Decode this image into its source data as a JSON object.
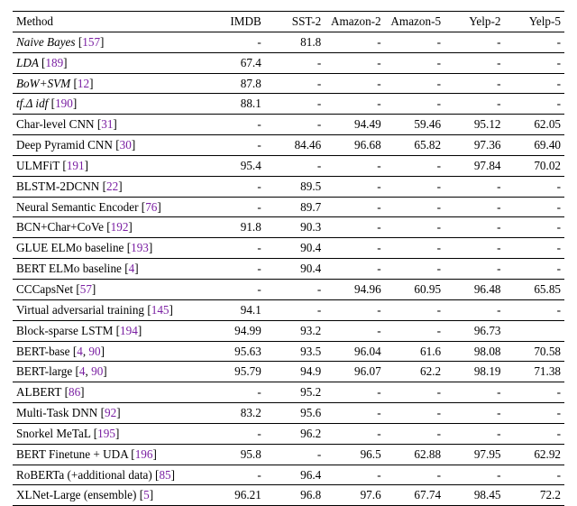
{
  "chart_data": {
    "type": "table",
    "title": "",
    "columns": [
      "Method",
      "IMDB",
      "SST-2",
      "Amazon-2",
      "Amazon-5",
      "Yelp-2",
      "Yelp-5"
    ],
    "rows": [
      {
        "method": "Naive Bayes",
        "ref": "157",
        "italic": true,
        "values": [
          "-",
          "81.8",
          "-",
          "-",
          "-",
          "-"
        ]
      },
      {
        "method": "LDA",
        "ref": "189",
        "italic": true,
        "values": [
          "67.4",
          "-",
          "-",
          "-",
          "-",
          "-"
        ]
      },
      {
        "method": "BoW+SVM",
        "ref": "12",
        "italic": true,
        "values": [
          "87.8",
          "-",
          "-",
          "-",
          "-",
          "-"
        ]
      },
      {
        "method": "tf.Δ idf",
        "ref": "190",
        "italic": true,
        "values": [
          "88.1",
          "-",
          "-",
          "-",
          "-",
          "-"
        ]
      },
      {
        "method": "Char-level CNN",
        "ref": "31",
        "italic": false,
        "values": [
          "-",
          "-",
          "94.49",
          "59.46",
          "95.12",
          "62.05"
        ]
      },
      {
        "method": "Deep Pyramid CNN",
        "ref": "30",
        "italic": false,
        "values": [
          "-",
          "84.46",
          "96.68",
          "65.82",
          "97.36",
          "69.40"
        ]
      },
      {
        "method": "ULMFiT",
        "ref": "191",
        "italic": false,
        "values": [
          "95.4",
          "-",
          "-",
          "-",
          "97.84",
          "70.02"
        ]
      },
      {
        "method": "BLSTM-2DCNN",
        "ref": "22",
        "italic": false,
        "values": [
          "-",
          "89.5",
          "-",
          "-",
          "-",
          "-"
        ]
      },
      {
        "method": "Neural Semantic Encoder",
        "ref": "76",
        "italic": false,
        "values": [
          "-",
          "89.7",
          "-",
          "-",
          "-",
          "-"
        ]
      },
      {
        "method": "BCN+Char+CoVe",
        "ref": "192",
        "italic": false,
        "values": [
          "91.8",
          "90.3",
          "-",
          "-",
          "-",
          "-"
        ]
      },
      {
        "method": "GLUE ELMo baseline",
        "ref": "193",
        "italic": false,
        "values": [
          "-",
          "90.4",
          "-",
          "-",
          "-",
          "-"
        ]
      },
      {
        "method": "BERT ELMo baseline",
        "ref": "4",
        "italic": false,
        "values": [
          "-",
          "90.4",
          "-",
          "-",
          "-",
          "-"
        ]
      },
      {
        "method": "CCCapsNet",
        "ref": "57",
        "italic": false,
        "values": [
          "-",
          "-",
          "94.96",
          "60.95",
          "96.48",
          "65.85"
        ]
      },
      {
        "method": "Virtual adversarial training",
        "ref": "145",
        "italic": false,
        "values": [
          "94.1",
          "-",
          "-",
          "-",
          "-",
          "-"
        ]
      },
      {
        "method": "Block-sparse LSTM",
        "ref": "194",
        "italic": false,
        "values": [
          "94.99",
          "93.2",
          "-",
          "-",
          "96.73",
          ""
        ]
      },
      {
        "method": "BERT-base",
        "ref": "4, 90",
        "italic": false,
        "values": [
          "95.63",
          "93.5",
          "96.04",
          "61.6",
          "98.08",
          "70.58"
        ]
      },
      {
        "method": "BERT-large",
        "ref": "4, 90",
        "italic": false,
        "values": [
          "95.79",
          "94.9",
          "96.07",
          "62.2",
          "98.19",
          "71.38"
        ]
      },
      {
        "method": "ALBERT",
        "ref": "86",
        "italic": false,
        "values": [
          "-",
          "95.2",
          "-",
          "-",
          "-",
          "-"
        ]
      },
      {
        "method": "Multi-Task DNN",
        "ref": "92",
        "italic": false,
        "values": [
          "83.2",
          "95.6",
          "-",
          "-",
          "-",
          "-"
        ]
      },
      {
        "method": "Snorkel MeTaL",
        "ref": "195",
        "italic": false,
        "values": [
          "-",
          "96.2",
          "-",
          "-",
          "-",
          "-"
        ]
      },
      {
        "method": "BERT Finetune + UDA",
        "ref": "196",
        "italic": false,
        "values": [
          "95.8",
          "-",
          "96.5",
          "62.88",
          "97.95",
          "62.92"
        ]
      },
      {
        "method": "RoBERTa (+additional data)",
        "ref": "85",
        "italic": false,
        "values": [
          "-",
          "96.4",
          "-",
          "-",
          "-",
          "-"
        ]
      },
      {
        "method": "XLNet-Large (ensemble)",
        "ref": "5",
        "italic": false,
        "values": [
          "96.21",
          "96.8",
          "97.6",
          "67.74",
          "98.45",
          "72.2"
        ]
      }
    ]
  },
  "headers": {
    "method": "Method",
    "c1": "IMDB",
    "c2": "SST-2",
    "c3": "Amazon-2",
    "c4": "Amazon-5",
    "c5": "Yelp-2",
    "c6": "Yelp-5"
  }
}
